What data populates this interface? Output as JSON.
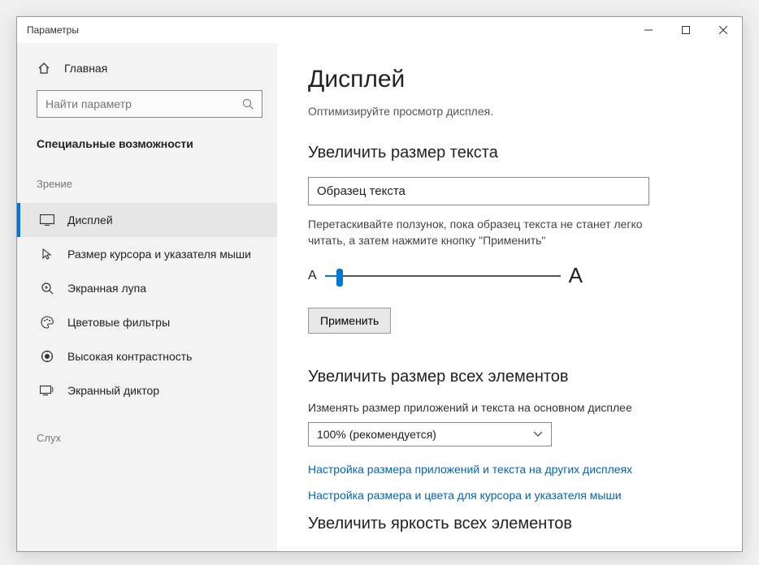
{
  "window": {
    "title": "Параметры"
  },
  "sidebar": {
    "home": "Главная",
    "search_placeholder": "Найти параметр",
    "category": "Специальные возможности",
    "groups": {
      "vision": "Зрение",
      "hearing": "Слух"
    },
    "items": [
      {
        "label": "Дисплей"
      },
      {
        "label": "Размер курсора и указателя мыши"
      },
      {
        "label": "Экранная лупа"
      },
      {
        "label": "Цветовые фильтры"
      },
      {
        "label": "Высокая контрастность"
      },
      {
        "label": "Экранный диктор"
      }
    ]
  },
  "main": {
    "title": "Дисплей",
    "subtitle": "Оптимизируйте просмотр дисплея.",
    "text_size": {
      "heading": "Увеличить размер текста",
      "sample": "Образец текста",
      "help": "Перетаскивайте ползунок, пока образец текста не станет легко читать, а затем нажмите кнопку \"Применить\"",
      "small_a": "A",
      "big_a": "A",
      "apply": "Применить"
    },
    "everything": {
      "heading": "Увеличить размер всех элементов",
      "label": "Изменять размер приложений и текста на основном дисплее",
      "dropdown_value": "100% (рекомендуется)",
      "link1": "Настройка размера приложений и текста на других дисплеях",
      "link2": "Настройка размера и цвета для курсора и указателя мыши"
    },
    "brightness_heading": "Увеличить яркость всех элементов"
  }
}
